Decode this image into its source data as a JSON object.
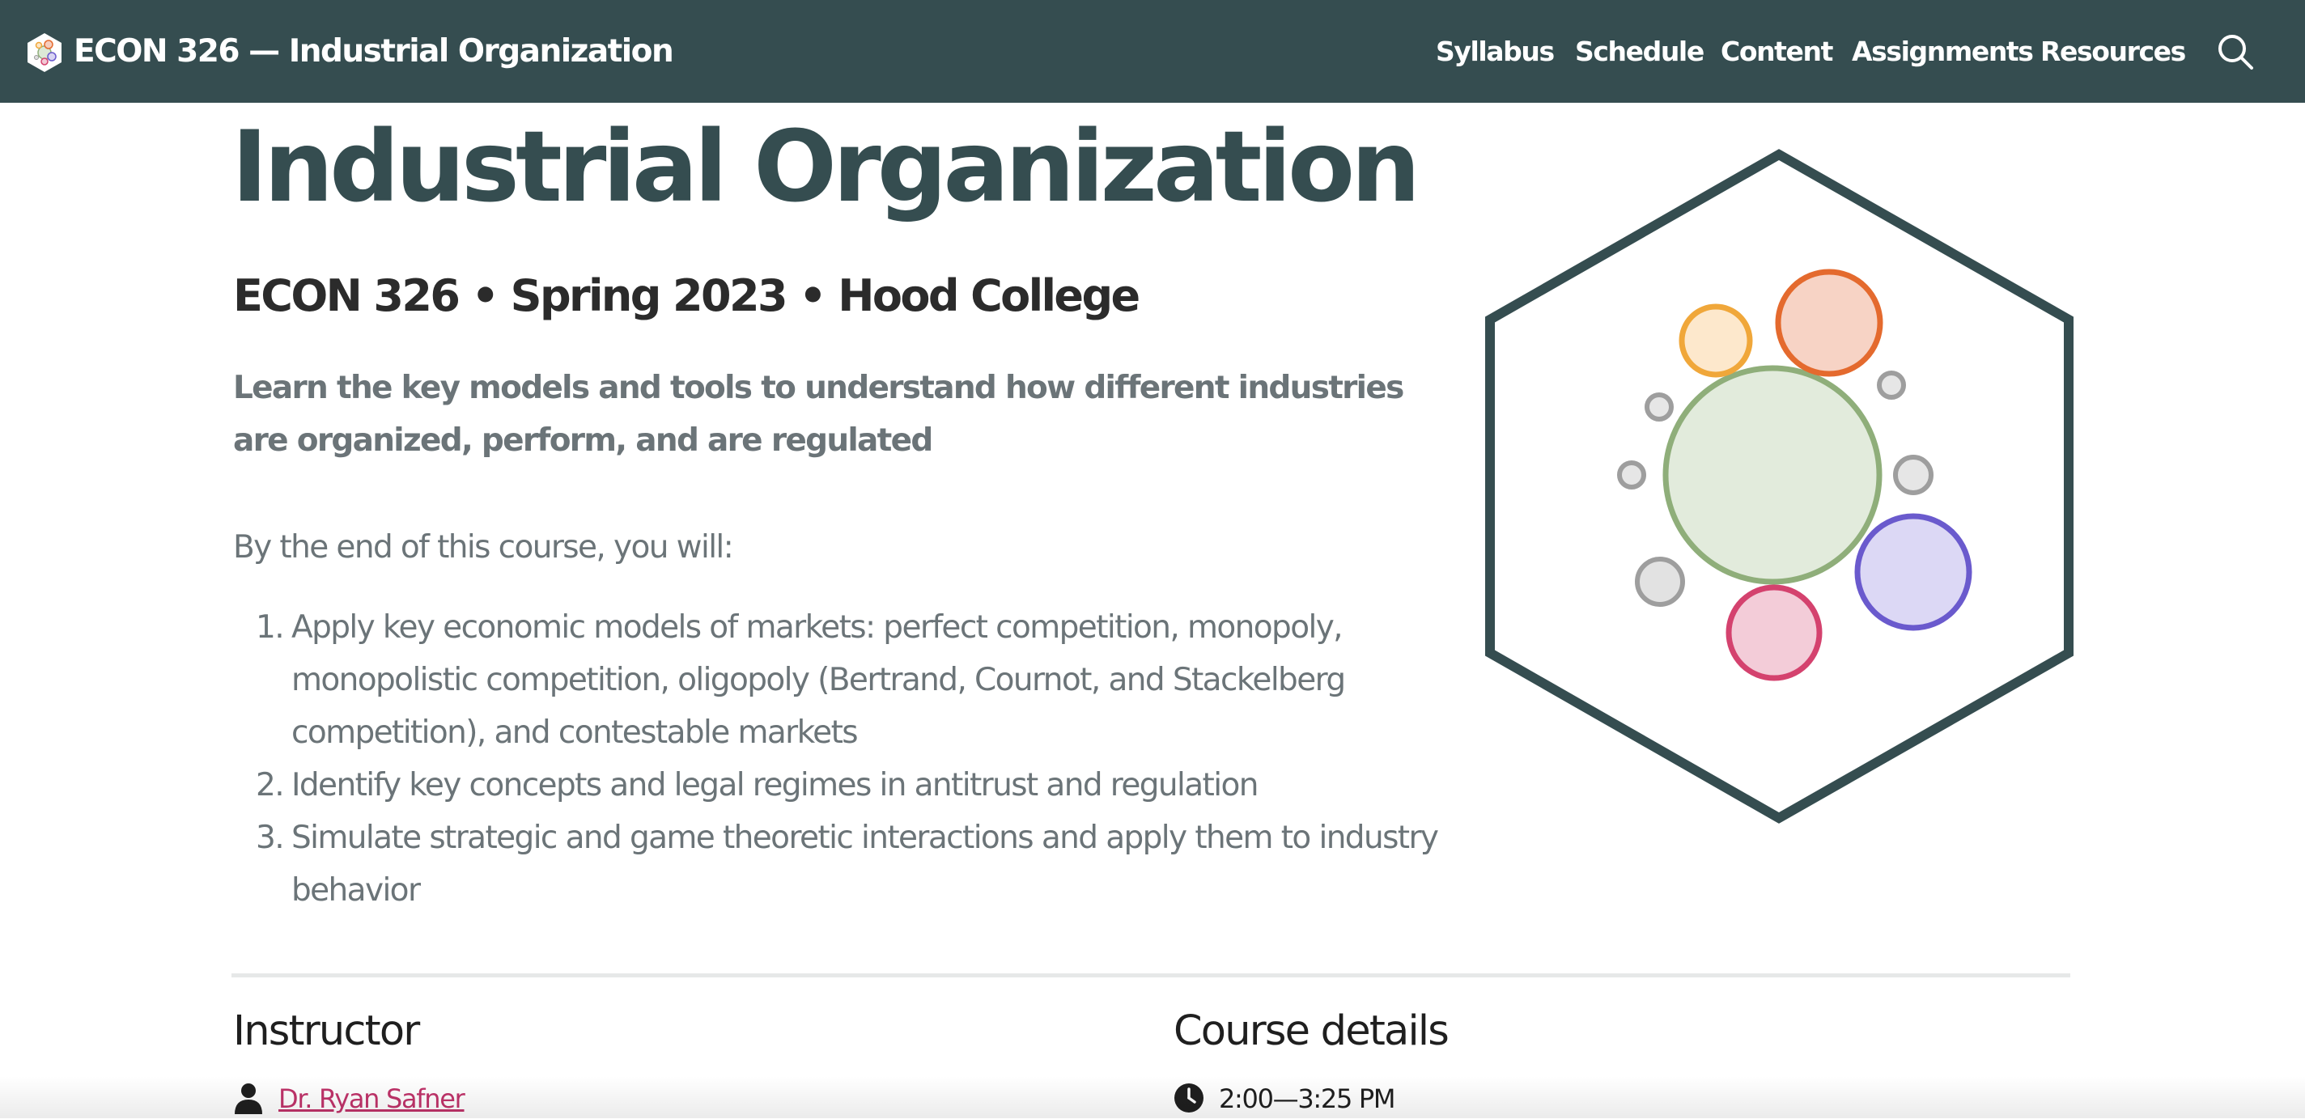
{
  "navbar": {
    "brand_title": "ECON 326 — Industrial Organization",
    "links": [
      "Syllabus",
      "Schedule",
      "Content",
      "Assignments",
      "Resources"
    ],
    "search_icon": "search-icon",
    "colors": {
      "background": "#354d50",
      "text": "#ffffff"
    }
  },
  "hero": {
    "title": "Industrial Organization",
    "subtitle": "ECON 326 • Spring 2023 • Hood College",
    "tagline": "Learn the key models and tools to understand how different industries are organized, perform, and are regulated",
    "intro": "By the end of this course, you will:",
    "goals": [
      "Apply key economic models of markets: perfect competition, monopoly, monopolistic competition, oligopoly (Bertrand, Cournot, and Stackelberg competition), and contestable markets",
      "Identify key concepts and legal regimes in antitrust and regulation",
      "Simulate strategic and game theoretic interactions and apply them to industry behavior"
    ],
    "goal_numbers": [
      "1.",
      "2.",
      "3."
    ],
    "logo": "hexagon-bubbles-logo"
  },
  "instructor": {
    "heading": "Instructor",
    "name": "Dr. Ryan Safner",
    "icon": "person-icon"
  },
  "course_details": {
    "heading": "Course details",
    "time": "2:00—3:25 PM",
    "icon": "clock-icon"
  },
  "colors": {
    "title": "#354d50",
    "muted_text": "#6b7478",
    "link": "#c0336a",
    "divider": "#e6e8e8"
  }
}
